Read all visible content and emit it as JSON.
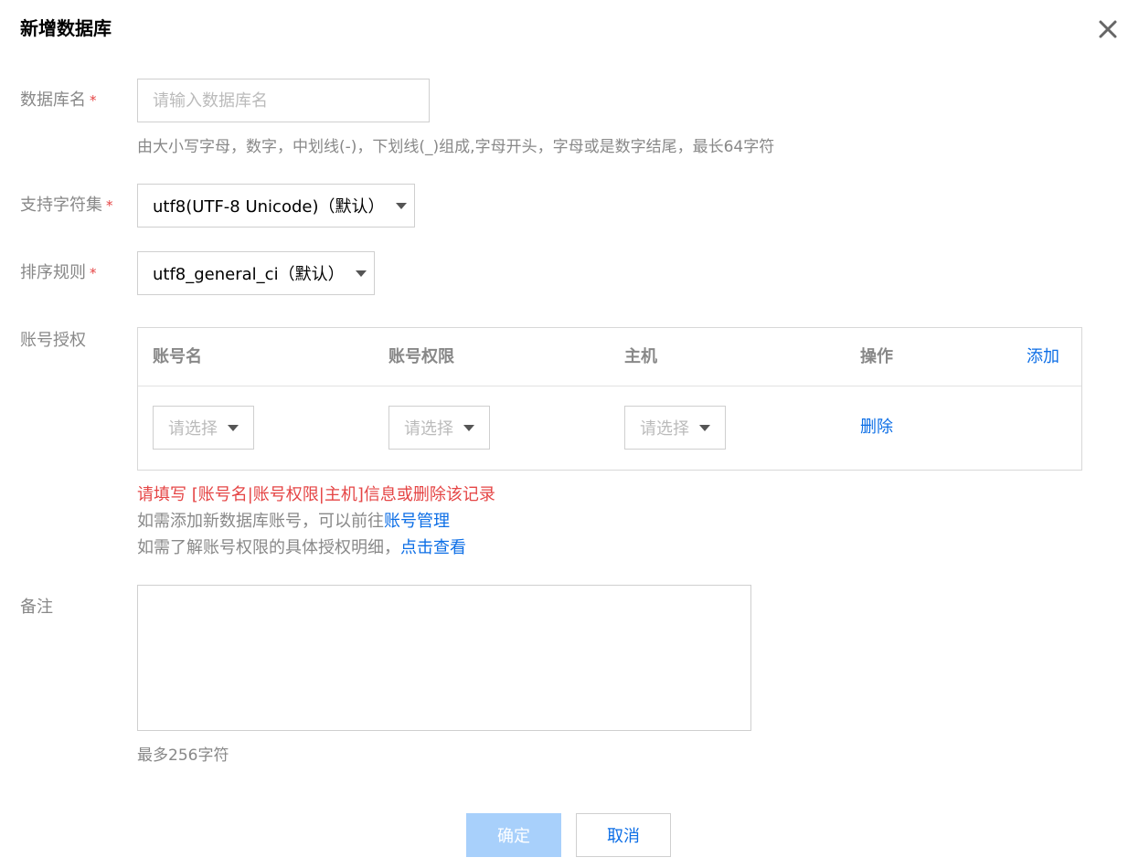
{
  "dialog": {
    "title": "新增数据库",
    "close_icon": "close-icon"
  },
  "db_name": {
    "label": "数据库名",
    "required_mark": "*",
    "placeholder": "请输入数据库名",
    "value": "",
    "hint": "由大小写字母，数字，中划线(-)，下划线(_)组成,字母开头，字母或是数字结尾，最长64字符"
  },
  "charset": {
    "label": "支持字符集",
    "required_mark": "*",
    "selected": "utf8(UTF-8 Unicode)（默认）"
  },
  "collation": {
    "label": "排序规则",
    "required_mark": "*",
    "selected": "utf8_general_ci（默认）"
  },
  "account_auth": {
    "label": "账号授权",
    "columns": {
      "account": "账号名",
      "privilege": "账号权限",
      "host": "主机",
      "operation": "操作"
    },
    "add_label": "添加",
    "row": {
      "account_placeholder": "请选择",
      "privilege_placeholder": "请选择",
      "host_placeholder": "请选择",
      "delete_label": "删除"
    },
    "error": "请填写 [账号名|账号权限|主机]信息或删除该记录",
    "info1_prefix": "如需添加新数据库账号，可以前往",
    "info1_link": "账号管理",
    "info2_prefix": "如需了解账号权限的具体授权明细，",
    "info2_link": "点击查看"
  },
  "remark": {
    "label": "备注",
    "value": "",
    "hint": "最多256字符"
  },
  "footer": {
    "confirm_label": "确定",
    "cancel_label": "取消"
  },
  "colors": {
    "link": "#0c6ee6",
    "error": "#e54545",
    "primary_disabled": "#a8d0fb"
  }
}
